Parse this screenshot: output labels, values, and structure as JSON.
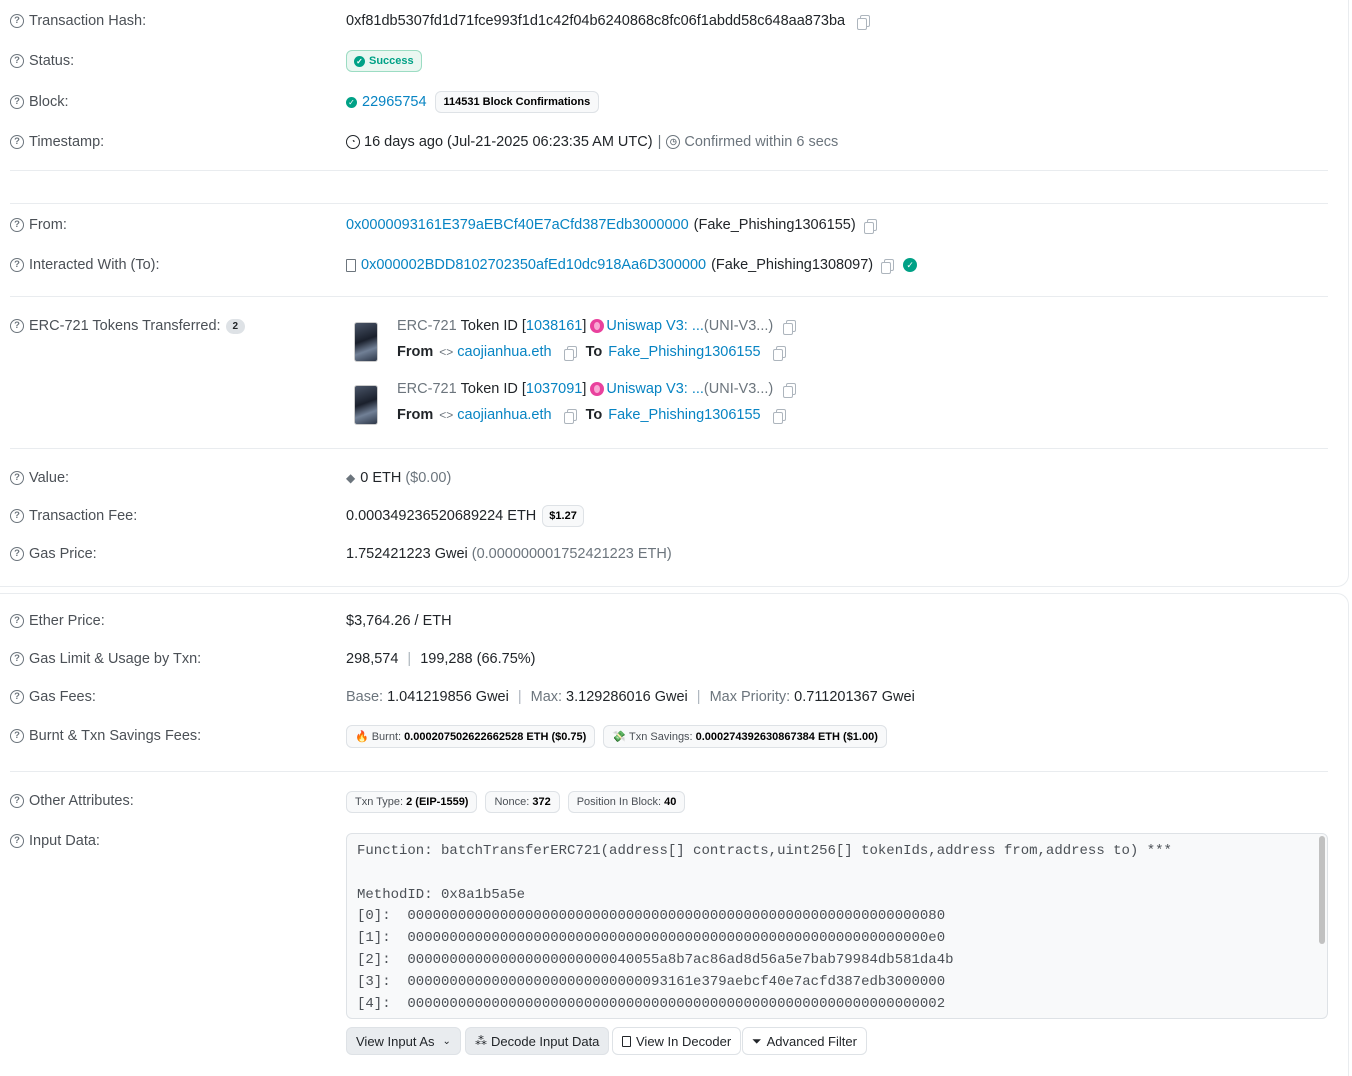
{
  "overview": {
    "tx_hash": {
      "label": "Transaction Hash:",
      "value": "0xf81db5307fd1d71fce993f1d1c42f04b6240868c8fc06f1abdd58c648aa873ba"
    },
    "status": {
      "label": "Status:",
      "value": "Success"
    },
    "block": {
      "label": "Block:",
      "number": "22965754",
      "confirmations": "114531 Block Confirmations"
    },
    "timestamp": {
      "label": "Timestamp:",
      "value": "16 days ago (Jul-21-2025 06:23:35 AM UTC)",
      "sep": "|",
      "confirmed": "Confirmed within 6 secs"
    },
    "from": {
      "label": "From:",
      "address": "0x0000093161E379aEBCf40E7aCfd387Edb3000000",
      "name": "(Fake_Phishing1306155)"
    },
    "to": {
      "label": "Interacted With (To):",
      "address": "0x000002BDD8102702350afEd10dc918Aa6D300000",
      "name": "(Fake_Phishing1308097)"
    },
    "erc721": {
      "label": "ERC-721 Tokens Transferred:",
      "count": "2",
      "items": [
        {
          "standard": "ERC-721",
          "token_label": "Token ID [",
          "token_id": "1038161",
          "token_close": "]",
          "collection": "Uniswap V3: ...",
          "symbol": "(UNI-V3...)",
          "from_label": "From",
          "from": "caojianhua.eth",
          "to_label": "To",
          "to": "Fake_Phishing1306155"
        },
        {
          "standard": "ERC-721",
          "token_label": "Token ID [",
          "token_id": "1037091",
          "token_close": "]",
          "collection": "Uniswap V3: ...",
          "symbol": "(UNI-V3...)",
          "from_label": "From",
          "from": "caojianhua.eth",
          "to_label": "To",
          "to": "Fake_Phishing1306155"
        }
      ]
    },
    "value": {
      "label": "Value:",
      "amount": "0 ETH",
      "usd": "($0.00)"
    },
    "fee": {
      "label": "Transaction Fee:",
      "amount": "0.000349236520689224 ETH",
      "usd": "$1.27"
    },
    "gas_price": {
      "label": "Gas Price:",
      "gwei": "1.752421223 Gwei",
      "eth": "(0.000000001752421223 ETH)"
    }
  },
  "more": {
    "ether_price": {
      "label": "Ether Price:",
      "value": "$3,764.26 / ETH"
    },
    "gas_limit": {
      "label": "Gas Limit & Usage by Txn:",
      "limit": "298,574",
      "sep": "|",
      "usage": "199,288 (66.75%)"
    },
    "gas_fees": {
      "label": "Gas Fees:",
      "base_k": "Base:",
      "base": "1.041219856 Gwei",
      "max_k": "Max:",
      "max": "3.129286016 Gwei",
      "prio_k": "Max Priority:",
      "prio": "0.711201367 Gwei",
      "sep": "|"
    },
    "burnt": {
      "label": "Burnt & Txn Savings Fees:",
      "burnt_k": "Burnt:",
      "burnt": "0.000207502622662528 ETH ($0.75)",
      "savings_k": "Txn Savings:",
      "savings": "0.000274392630867384 ETH ($1.00)"
    },
    "other": {
      "label": "Other Attributes:",
      "type_k": "Txn Type:",
      "type": "2 (EIP-1559)",
      "nonce_k": "Nonce:",
      "nonce": "372",
      "pos_k": "Position In Block:",
      "pos": "40"
    },
    "input": {
      "label": "Input Data:",
      "lines": [
        "Function: batchTransferERC721(address[] contracts,uint256[] tokenIds,address from,address to) ***",
        "",
        "MethodID: 0x8a1b5a5e",
        "[0]:  0000000000000000000000000000000000000000000000000000000000000080",
        "[1]:  00000000000000000000000000000000000000000000000000000000000000e0",
        "[2]:  000000000000000000000000040055a8b7ac86ad8d56a5e7bab79984db581da4b",
        "[3]:  0000000000000000000000000000093161e379aebcf40e7acfd387edb3000000",
        "[4]:  0000000000000000000000000000000000000000000000000000000000000002"
      ],
      "buttons": {
        "view_as": "View Input As",
        "decode": "Decode Input Data",
        "decoder": "View In Decoder",
        "filter": "Advanced Filter"
      }
    }
  }
}
